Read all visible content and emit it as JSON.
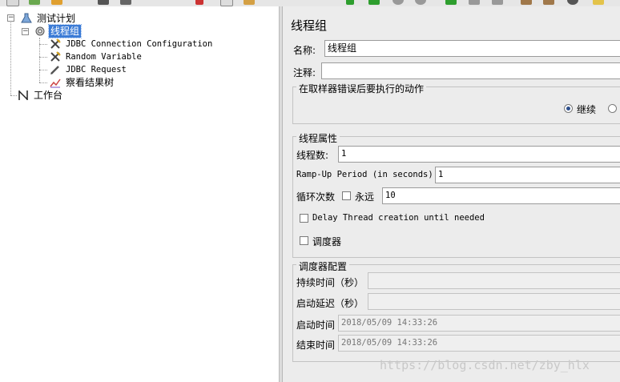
{
  "tree": {
    "root": "测试计划",
    "thread_group": "线程组",
    "children": [
      "JDBC Connection Configuration",
      "Random Variable",
      "JDBC Request",
      "察看结果树"
    ],
    "workbench": "工作台"
  },
  "panel": {
    "title": "线程组",
    "name_label": "名称:",
    "name_value": "线程组",
    "comment_label": "注释:",
    "comment_value": "",
    "error_action": {
      "legend": "在取样器错误后要执行的动作",
      "continue_label": "继续",
      "continue_selected": true
    },
    "thread_props": {
      "legend": "线程属性",
      "threads_label": "线程数:",
      "threads_value": "1",
      "rampup_label": "Ramp-Up Period (in seconds):",
      "rampup_value": "1",
      "loop_label": "循环次数",
      "forever_label": "永远",
      "forever_checked": false,
      "loop_value": "10",
      "delay_label": "Delay Thread creation until needed",
      "delay_checked": false,
      "scheduler_label": "调度器",
      "scheduler_checked": false
    },
    "scheduler_config": {
      "legend": "调度器配置",
      "duration_label": "持续时间（秒）",
      "duration_value": "",
      "startup_delay_label": "启动延迟（秒）",
      "startup_delay_value": "",
      "start_time_label": "启动时间",
      "start_time_value": "2018/05/09 14:33:26",
      "end_time_label": "结束时间",
      "end_time_value": "2018/05/09 14:33:26"
    }
  },
  "watermark": "https://blog.csdn.net/zby_hlx",
  "colors": {
    "selection": "#3b7bd6",
    "panel_bg": "#ececec",
    "tree_bg": "#ffffff"
  }
}
